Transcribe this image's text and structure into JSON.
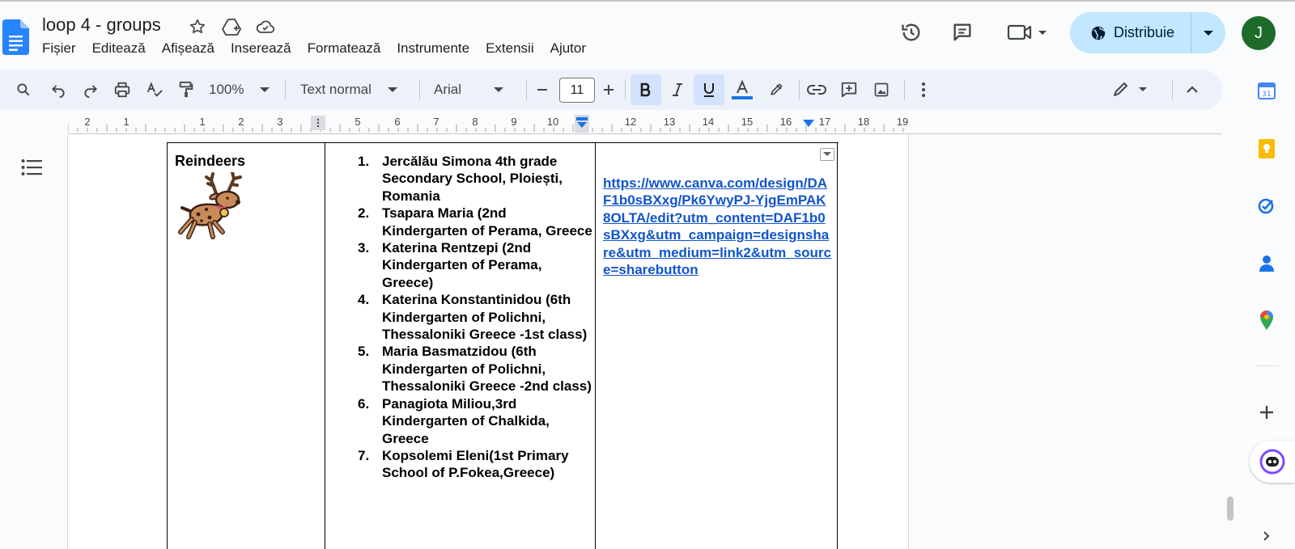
{
  "window": {
    "title": "loop 4 - groups"
  },
  "menubar": [
    "Fișier",
    "Editează",
    "Afișează",
    "Inserează",
    "Formatează",
    "Instrumente",
    "Extensii",
    "Ajutor"
  ],
  "header": {
    "share_label": "Distribuie",
    "avatar_initial": "J"
  },
  "toolbar": {
    "zoom": "100%",
    "style": "Text normal",
    "font": "Arial",
    "font_size": "11",
    "bold_active": true,
    "underline_active": true
  },
  "ruler": {
    "numbers": [
      "2",
      "1",
      "1",
      "2",
      "3",
      "5",
      "6",
      "7",
      "8",
      "9",
      "10",
      "12",
      "13",
      "14",
      "15",
      "16",
      "17",
      "18",
      "19"
    ]
  },
  "table": {
    "group_name": "Reindeers",
    "members": [
      "Jercălău Simona 4th grade Secondary School, Ploiești, Romania",
      "Tsapara Maria (2nd Kindergarten of Perama, Greece",
      "Katerina Rentzepi (2nd Kindergarten of Perama, Greece)",
      "Katerina Konstantinidou (6th Kindergarten of Polichni, Thessaloniki Greece -1st class)",
      "Maria Basmatzidou (6th Kindergarten of Polichni, Thessaloniki Greece -2nd class)",
      "Panagiota Miliou,3rd Kindergarten of Chalkida, Greece",
      "Kopsolemi Eleni(1st Primary School of P.Fokea,Greece)"
    ],
    "link": "https://www.canva.com/design/DAF1b0sBXxg/Pk6YwyPJ-YjgEmPAK8OLTA/edit?utm_content=DAF1b0sBXxg&utm_campaign=designshare&utm_medium=link2&utm_source=sharebutton"
  },
  "colors": {
    "accent": "#1a73e8",
    "share_bg": "#c2e7ff",
    "toolbar_bg": "#edf2fa",
    "link": "#1155cc",
    "avatar": "#1e6b2a"
  }
}
